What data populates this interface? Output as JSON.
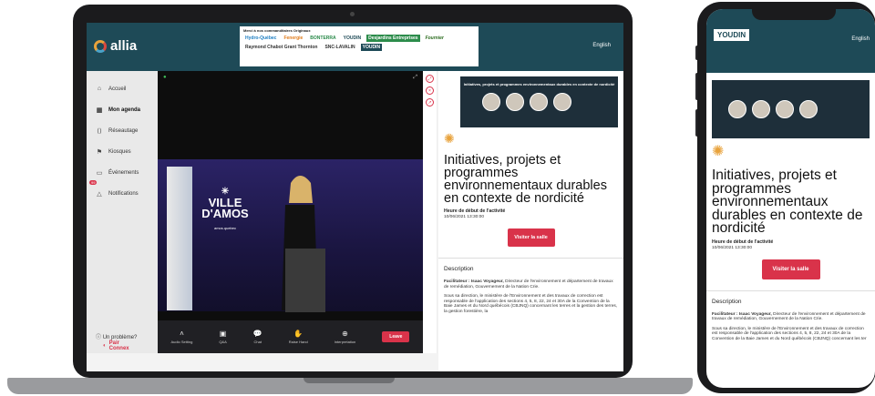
{
  "app": {
    "logo_text": "allia",
    "language": "English"
  },
  "sponsors": {
    "title": "Merci à nos commanditaires Originaux",
    "items": [
      "Hydro-Québec",
      "Fenergie",
      "BONTERRA",
      "YOUDIN",
      "Desjardins Entreprises",
      "Fournier",
      "Raymond Chabot Grant Thornton",
      "SNC-LAVALIN",
      "YOUDIN"
    ]
  },
  "sidebar": {
    "items": [
      {
        "label": "Accueil",
        "icon": "home-icon"
      },
      {
        "label": "Mon agenda",
        "icon": "calendar-icon",
        "active": true
      },
      {
        "label": "Réseautage",
        "icon": "network-icon"
      },
      {
        "label": "Kiosques",
        "icon": "kiosk-icon"
      },
      {
        "label": "Événements",
        "icon": "events-icon"
      },
      {
        "label": "Notifications",
        "icon": "bell-icon",
        "badge": "99"
      }
    ],
    "help": "Un problème?",
    "brand": "Pair Connex"
  },
  "video": {
    "banner_line1": "VILLE",
    "banner_line2": "D'AMOS",
    "banner_sub": "amos.quebec",
    "controls": [
      {
        "label": "Audio Setting",
        "icon": "audio-icon"
      },
      {
        "label": "Q&A",
        "icon": "qa-icon"
      },
      {
        "label": "Chat",
        "icon": "chat-icon"
      },
      {
        "label": "Raise Hand",
        "icon": "hand-icon"
      },
      {
        "label": "Interpretation",
        "icon": "globe-icon"
      }
    ],
    "leave": "Leave"
  },
  "session": {
    "thumb_title": "Initiatives, projets et programmes environnementaux durables en contexte de nordicité",
    "title": "Initiatives, projets et programmes environnementaux durables en contexte de nordicité",
    "start_label": "Heure de début de l'activité",
    "start_value": "10/06/2021 13:30:00",
    "visit_button": "Visiter la salle",
    "desc_heading": "Description",
    "facilitator_label": "Facilitateur : Isaac Voyageur,",
    "facilitator_text": "Directeur de l'environnement et département de travaux de remédiation, Gouvernement de la Nation Crie.",
    "body": "Sous sa direction, le ministère de l'Environnement et des travaux de correction est responsable de l'application des sections 4, 5, 8, 22, 24 et 30A de la Convention de la Baie James et du Nord québécois (CBJNQ) concernant les terres et la gestion des terres, la gestion forestière, la"
  },
  "phone": {
    "logo": "YOUDIN",
    "language": "English",
    "title": "Initiatives, projets et programmes environnementaux durables en contexte de nordicité",
    "start_label": "Heure de début de l'activité",
    "start_value": "10/06/2021 13:30:00",
    "visit_button": "Visiter la salle",
    "desc_heading": "Description",
    "facilitator_label": "Facilitateur : Isaac Voyageur,",
    "facilitator_text": "Directeur de l'environnement et département de travaux de remédiation, Gouvernement de la Nation Crie.",
    "body": "Sous sa direction, le ministère de l'Environnement et des travaux de correction est responsable de l'application des sections 4, 5, 8, 22, 24 et 30A de la Convention de la Baie James et du Nord québécois (CBJNQ) concernant les ter"
  }
}
